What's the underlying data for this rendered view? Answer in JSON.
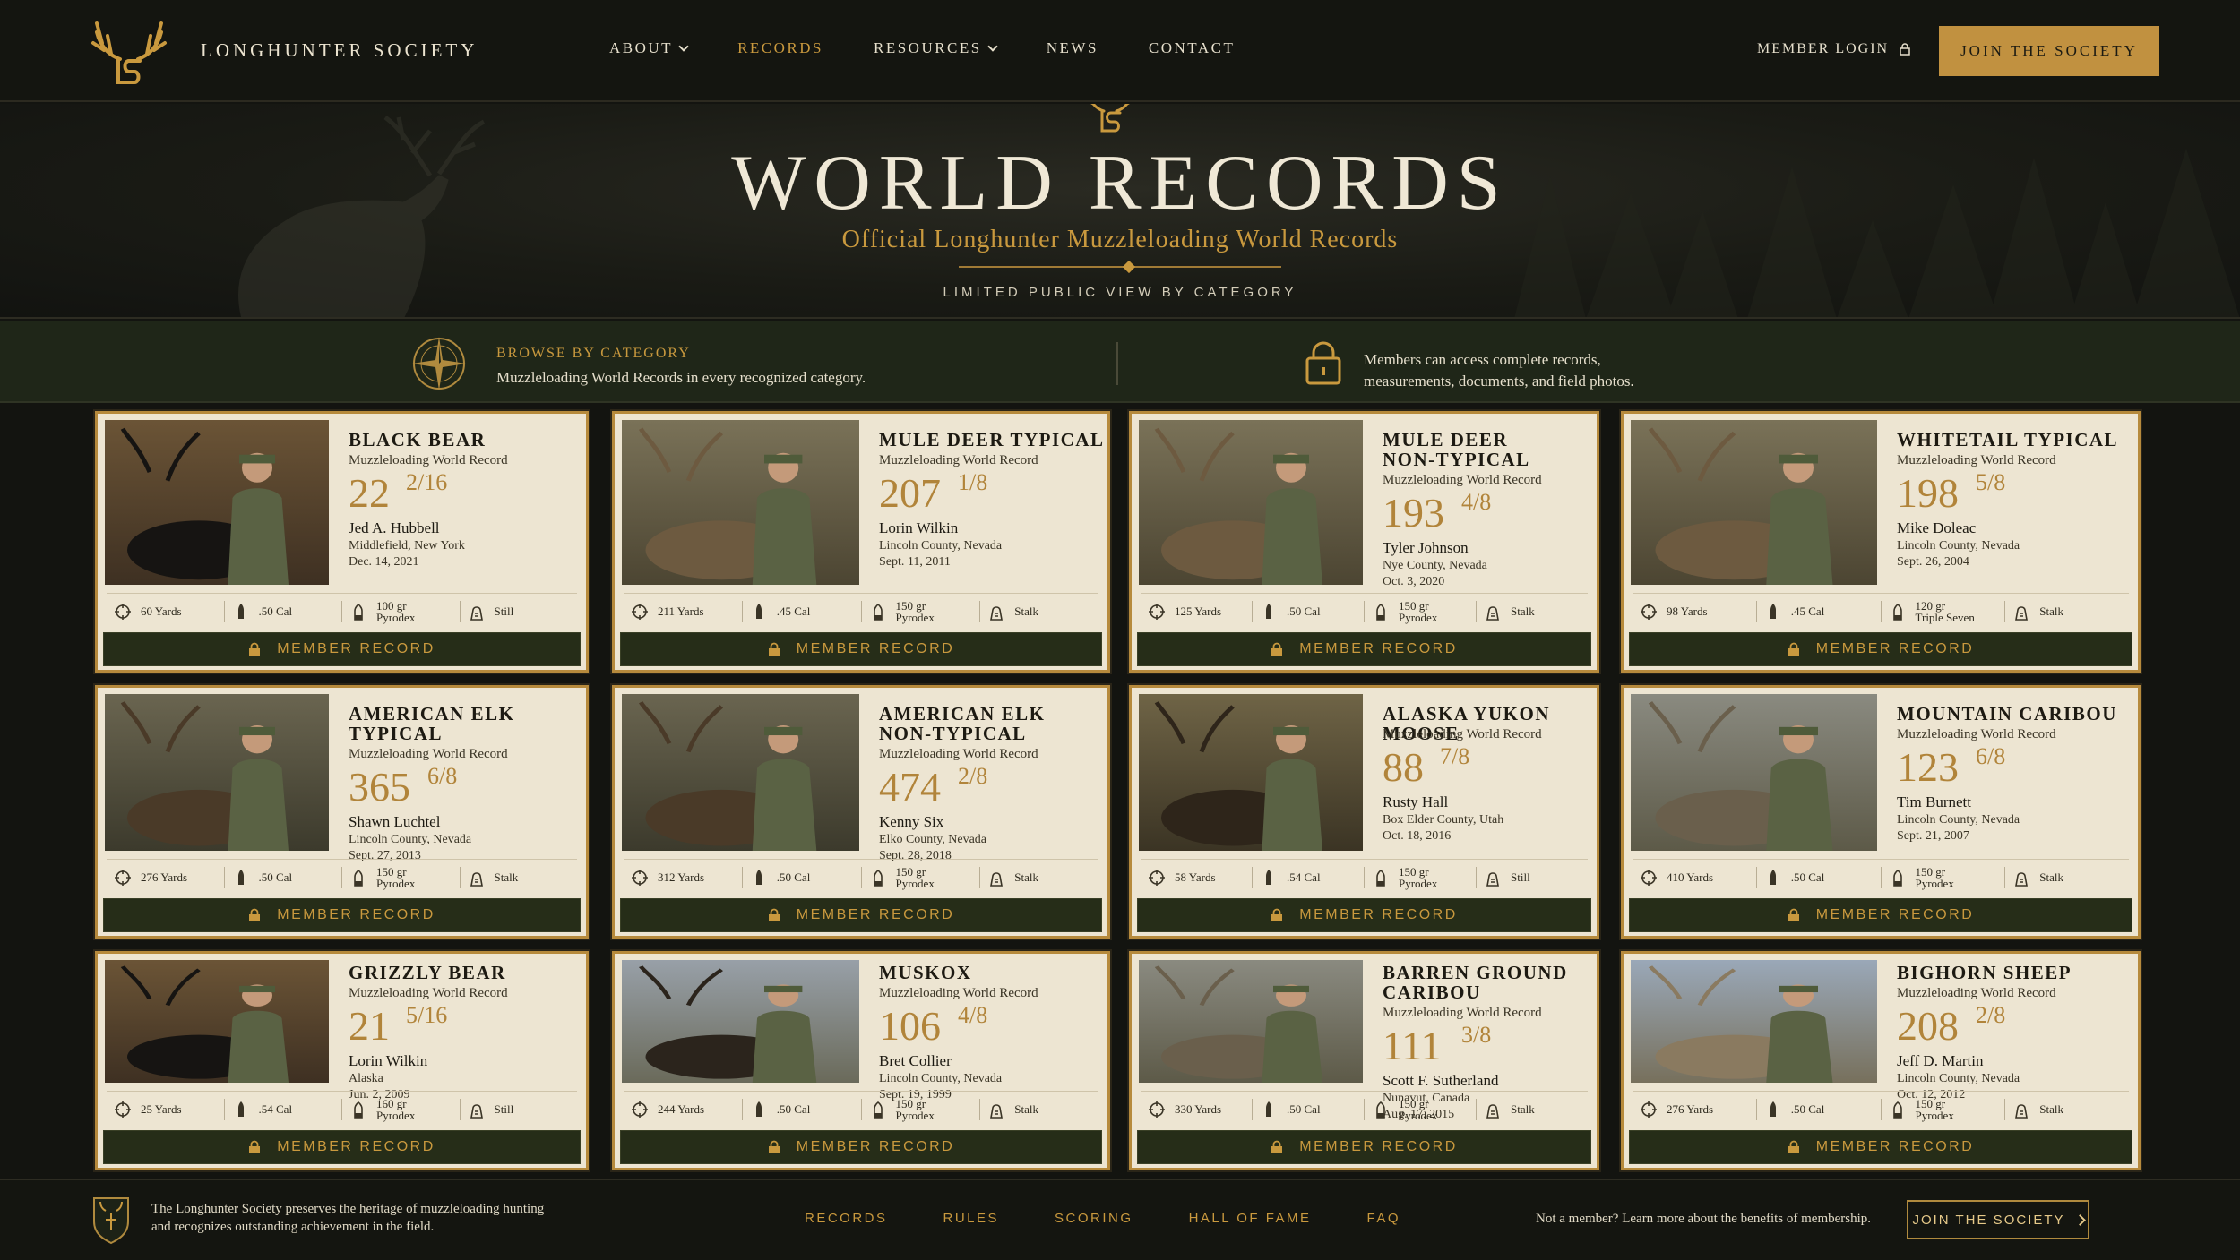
{
  "header": {
    "brand": "LONGHUNTER SOCIETY",
    "nav": [
      {
        "label": "ABOUT",
        "dropdown": true,
        "active": false
      },
      {
        "label": "RECORDS",
        "dropdown": false,
        "active": true
      },
      {
        "label": "RESOURCES",
        "dropdown": true,
        "active": false
      },
      {
        "label": "NEWS",
        "dropdown": false,
        "active": false
      },
      {
        "label": "CONTACT",
        "dropdown": false,
        "active": false
      }
    ],
    "login_label": "MEMBER LOGIN",
    "join_label": "JOIN THE SOCIETY"
  },
  "hero": {
    "title": "WORLD RECORDS",
    "subtitle": "Official Longhunter Muzzleloading World Records",
    "note": "LIMITED PUBLIC VIEW BY CATEGORY"
  },
  "infobar": {
    "browse_title": "BROWSE BY CATEGORY",
    "browse_text": "Muzzleloading World Records in every recognized category.",
    "members_line1": "Members can access complete records,",
    "members_line2": "measurements, documents, and field photos."
  },
  "colors": {
    "accent": "#c19140",
    "dark_green": "#262d18",
    "card_bg": "#ede5d2",
    "page_bg": "#131410"
  },
  "record_subtitle": "Muzzleloading World Record",
  "member_button_label": "MEMBER RECORD",
  "records": [
    {
      "title": [
        "BLACK BEAR"
      ],
      "score": "22",
      "frac": "2/16",
      "hunter": "Jed A. Hubbell",
      "location": "Middlefield, New York",
      "date": "Dec. 14, 2021",
      "distance": "60 Yards",
      "caliber": ".50 Cal",
      "bullet": [
        "100 gr",
        "Pyrodex"
      ],
      "method": "Still",
      "photo": "bear"
    },
    {
      "title": [
        "MULE DEER TYPICAL"
      ],
      "score": "207",
      "frac": "1/8",
      "hunter": "Lorin Wilkin",
      "location": "Lincoln County, Nevada",
      "date": "Sept. 11, 2011",
      "distance": "211 Yards",
      "caliber": ".45 Cal",
      "bullet": [
        "150 gr",
        "Pyrodex"
      ],
      "method": "Stalk",
      "photo": "deer"
    },
    {
      "title": [
        "MULE DEER",
        "NON-TYPICAL"
      ],
      "score": "193",
      "frac": "4/8",
      "hunter": "Tyler Johnson",
      "location": "Nye County, Nevada",
      "date": "Oct. 3, 2020",
      "distance": "125 Yards",
      "caliber": ".50 Cal",
      "bullet": [
        "150 gr",
        "Pyrodex"
      ],
      "method": "Stalk",
      "photo": "deer"
    },
    {
      "title": [
        "WHITETAIL TYPICAL"
      ],
      "score": "198",
      "frac": "5/8",
      "hunter": "Mike Doleac",
      "location": "Lincoln County, Nevada",
      "date": "Sept. 26, 2004",
      "distance": "98 Yards",
      "caliber": ".45 Cal",
      "bullet": [
        "120 gr",
        "Triple Seven"
      ],
      "method": "Stalk",
      "photo": "deer"
    },
    {
      "title": [
        "AMERICAN ELK",
        "TYPICAL"
      ],
      "score": "365",
      "frac": "6/8",
      "hunter": "Shawn Luchtel",
      "location": "Lincoln County, Nevada",
      "date": "Sept. 27, 2013",
      "distance": "276 Yards",
      "caliber": ".50 Cal",
      "bullet": [
        "150 gr",
        "Pyrodex"
      ],
      "method": "Stalk",
      "photo": "elk"
    },
    {
      "title": [
        "AMERICAN ELK",
        "NON-TYPICAL"
      ],
      "score": "474",
      "frac": "2/8",
      "hunter": "Kenny Six",
      "location": "Elko County, Nevada",
      "date": "Sept. 28, 2018",
      "distance": "312 Yards",
      "caliber": ".50 Cal",
      "bullet": [
        "150 gr",
        "Pyrodex"
      ],
      "method": "Stalk",
      "photo": "elk"
    },
    {
      "title": [
        "ALASKA YUKON MOOSE"
      ],
      "score": "88",
      "frac": "7/8",
      "hunter": "Rusty Hall",
      "location": "Box Elder County, Utah",
      "date": "Oct. 18, 2016",
      "distance": "58 Yards",
      "caliber": ".54 Cal",
      "bullet": [
        "150 gr",
        "Pyrodex"
      ],
      "method": "Still",
      "photo": "moose"
    },
    {
      "title": [
        "MOUNTAIN CARIBOU"
      ],
      "score": "123",
      "frac": "6/8",
      "hunter": "Tim Burnett",
      "location": "Lincoln County, Nevada",
      "date": "Sept. 21, 2007",
      "distance": "410 Yards",
      "caliber": ".50 Cal",
      "bullet": [
        "150 gr",
        "Pyrodex"
      ],
      "method": "Stalk",
      "photo": "caribou"
    },
    {
      "title": [
        "GRIZZLY BEAR"
      ],
      "score": "21",
      "frac": "5/16",
      "hunter": "Lorin Wilkin",
      "location": "Alaska",
      "date": "Jun. 2, 2009",
      "distance": "25 Yards",
      "caliber": ".54 Cal",
      "bullet": [
        "160 gr",
        "Pyrodex"
      ],
      "method": "Still",
      "photo": "bear"
    },
    {
      "title": [
        "MUSKOX"
      ],
      "score": "106",
      "frac": "4/8",
      "hunter": "Bret Collier",
      "location": "Lincoln County, Nevada",
      "date": "Sept. 19, 1999",
      "distance": "244 Yards",
      "caliber": ".50 Cal",
      "bullet": [
        "150 gr",
        "Pyrodex"
      ],
      "method": "Stalk",
      "photo": "muskox"
    },
    {
      "title": [
        "BARREN GROUND",
        "CARIBOU"
      ],
      "score": "111",
      "frac": "3/8",
      "hunter": "Scott F. Sutherland",
      "location": "Nunavut, Canada",
      "date": "Aug. 17, 2015",
      "distance": "330 Yards",
      "caliber": ".50 Cal",
      "bullet": [
        "150 gr",
        "Pyrodex"
      ],
      "method": "Stalk",
      "photo": "caribou"
    },
    {
      "title": [
        "BIGHORN SHEEP"
      ],
      "score": "208",
      "frac": "2/8",
      "hunter": "Jeff D. Martin",
      "location": "Lincoln County, Nevada",
      "date": "Oct. 12, 2012",
      "distance": "276 Yards",
      "caliber": ".50 Cal",
      "bullet": [
        "150 gr",
        "Pyrodex"
      ],
      "method": "Stalk",
      "photo": "sheep"
    }
  ],
  "footer": {
    "about_line1": "The Longhunter Society preserves the heritage of muzzleloading hunting",
    "about_line2": "and recognizes outstanding achievement in the field.",
    "links": [
      "RECORDS",
      "RULES",
      "SCORING",
      "HALL OF FAME",
      "FAQ"
    ],
    "not_member": "Not a member? Learn more about the benefits of membership.",
    "join_label": "JOIN THE SOCIETY"
  }
}
